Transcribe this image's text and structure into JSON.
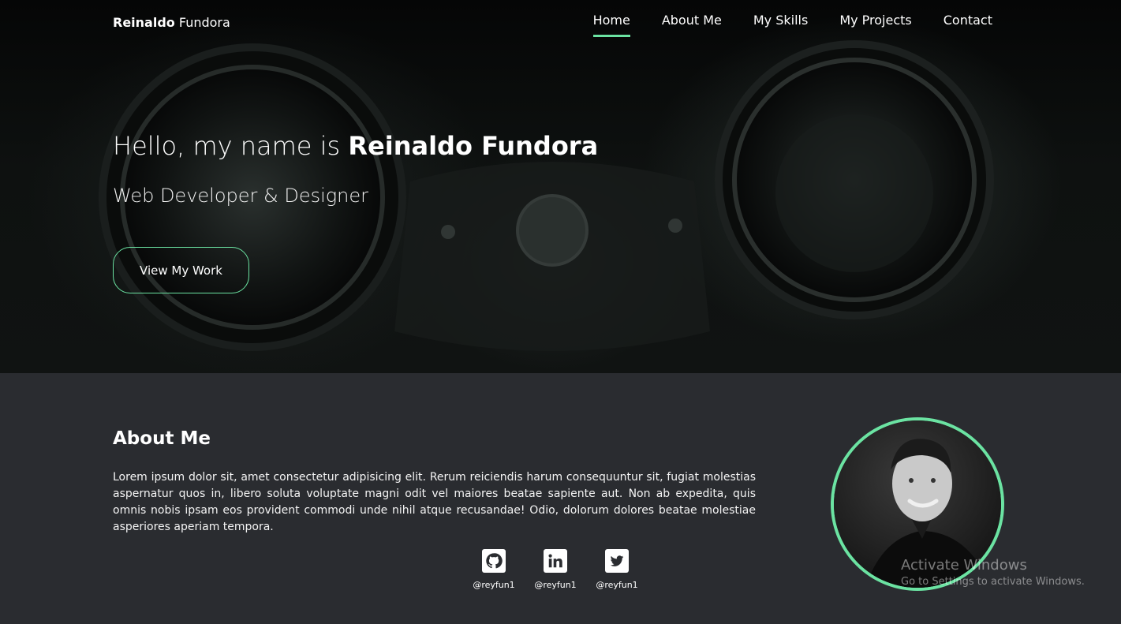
{
  "brand": {
    "first": "Reinaldo",
    "last": "Fundora"
  },
  "nav": {
    "items": [
      {
        "label": "Home",
        "active": true
      },
      {
        "label": "About Me"
      },
      {
        "label": "My Skills"
      },
      {
        "label": "My Projects"
      },
      {
        "label": "Contact"
      }
    ]
  },
  "hero": {
    "greeting": "Hello, my name is",
    "name": "Reinaldo Fundora",
    "role": "Web Developer & Designer",
    "cta_label": "View My Work"
  },
  "about": {
    "title": "About Me",
    "text": "Lorem ipsum dolor sit, amet consectetur adipisicing elit. Rerum reiciendis harum consequuntur sit, fugiat molestias aspernatur quos in, libero soluta voluptate magni odit vel maiores beatae sapiente aut. Non ab expedita, quis omnis nobis ipsam eos provident commodi unde nihil atque recusandae! Odio, dolorum dolores beatae molestiae asperiores aperiam tempora.",
    "socials": [
      {
        "icon": "github-icon",
        "handle": "@reyfun1"
      },
      {
        "icon": "linkedin-icon",
        "handle": "@reyfun1"
      },
      {
        "icon": "twitter-icon",
        "handle": "@reyfun1"
      }
    ]
  },
  "watermark": {
    "line1": "Activate Windows",
    "line2": "Go to Settings to activate Windows."
  },
  "colors": {
    "accent": "#6be3a2",
    "about_bg": "#2a2c30",
    "hero_bg": "#0b0d0c"
  }
}
